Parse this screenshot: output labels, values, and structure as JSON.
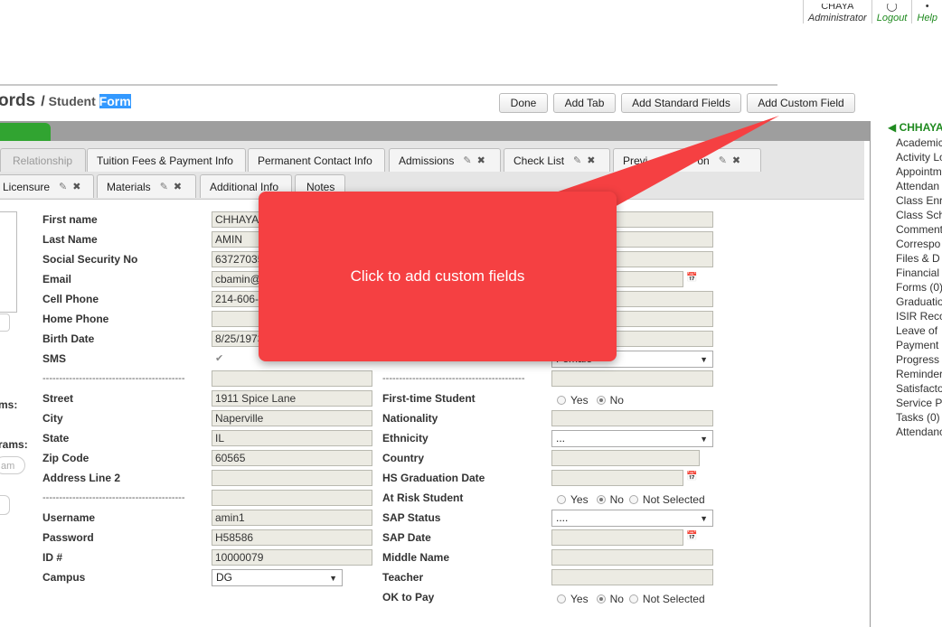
{
  "user": {
    "role": "Administrator",
    "name_top": "CHAYA",
    "logout": "Logout",
    "help": "Help"
  },
  "breadcrumb": {
    "section": "ords",
    "separator": "/",
    "page": "Student ",
    "page_highlight": "Form"
  },
  "toolbar": {
    "done": "Done",
    "add_tab": "Add Tab",
    "add_standard_fields": "Add Standard Fields",
    "add_custom_field": "Add Custom Field"
  },
  "tabs_row1": [
    {
      "label": "Relationship"
    },
    {
      "label": "Tuition Fees & Payment Info"
    },
    {
      "label": "Permanent Contact Info"
    },
    {
      "label": "Admissions"
    },
    {
      "label": "Check List"
    },
    {
      "label": "Previ",
      "tail": "on"
    }
  ],
  "tabs_row2": [
    {
      "label": "Licensure"
    },
    {
      "label": "Materials"
    },
    {
      "label": "Additional Info"
    },
    {
      "label": "Notes"
    }
  ],
  "form_left": {
    "first_name": {
      "label": "First name",
      "value": "CHHAYA"
    },
    "last_name": {
      "label": "Last Name",
      "value": "AMIN"
    },
    "ssn": {
      "label": "Social Security No",
      "value": "63727035"
    },
    "email": {
      "label": "Email",
      "value": "cbamin@"
    },
    "cell": {
      "label": "Cell Phone",
      "value": "214-606-"
    },
    "home": {
      "label": "Home Phone",
      "value": ""
    },
    "birth": {
      "label": "Birth Date",
      "value": "8/25/1973"
    },
    "sms": {
      "label": "SMS"
    },
    "divider": "-------------------------------------------",
    "street": {
      "label": "Street",
      "value": "1911 Spice Lane"
    },
    "city": {
      "label": "City",
      "value": "Naperville"
    },
    "state": {
      "label": "State",
      "value": "IL"
    },
    "zip": {
      "label": "Zip Code",
      "value": "60565"
    },
    "address2": {
      "label": "Address Line 2",
      "value": ""
    },
    "username": {
      "label": "Username",
      "value": "amin1"
    },
    "password": {
      "label": "Password",
      "value": "H58586"
    },
    "id": {
      "label": "ID #",
      "value": "10000079"
    },
    "campus": {
      "label": "Campus",
      "value": "DG"
    }
  },
  "form_right": {
    "gender_value": "Female",
    "first_time": {
      "label": "First-time Student",
      "yes": "Yes",
      "no": "No"
    },
    "nationality": {
      "label": "Nationality"
    },
    "ethnicity": {
      "label": "Ethnicity",
      "value": "..."
    },
    "country": {
      "label": "Country"
    },
    "hs_grad": {
      "label": "HS Graduation Date"
    },
    "at_risk": {
      "label": "At Risk Student",
      "yes": "Yes",
      "no": "No",
      "not_selected": "Not Selected"
    },
    "sap_status": {
      "label": "SAP Status",
      "value": "...."
    },
    "sap_date": {
      "label": "SAP Date"
    },
    "middle": {
      "label": "Middle Name"
    },
    "teacher": {
      "label": "Teacher"
    },
    "ok_pay": {
      "label": "OK to Pay",
      "yes": "Yes",
      "no": "No",
      "not_selected": "Not Selected"
    }
  },
  "left_edge": {
    "programs1": "ms:",
    "programs2": "rams:",
    "program_input": "am"
  },
  "sidebar": {
    "title": "CHHAYA",
    "items": [
      "Academic",
      "Activity Lo",
      "Appointm",
      "Attendan",
      "Class Enr",
      "Class Sch",
      "Comment",
      "Correspo",
      "Files & D",
      "Financial",
      "Forms (0)",
      "Graduatio",
      "ISIR Reco",
      "Leave of",
      "Payment",
      "Progress",
      "Reminder",
      "Satisfacto",
      "Service P",
      "Tasks (0)",
      "Attendanc"
    ]
  },
  "callout": {
    "text": "Click to add custom fields",
    "color": "#f54042"
  }
}
